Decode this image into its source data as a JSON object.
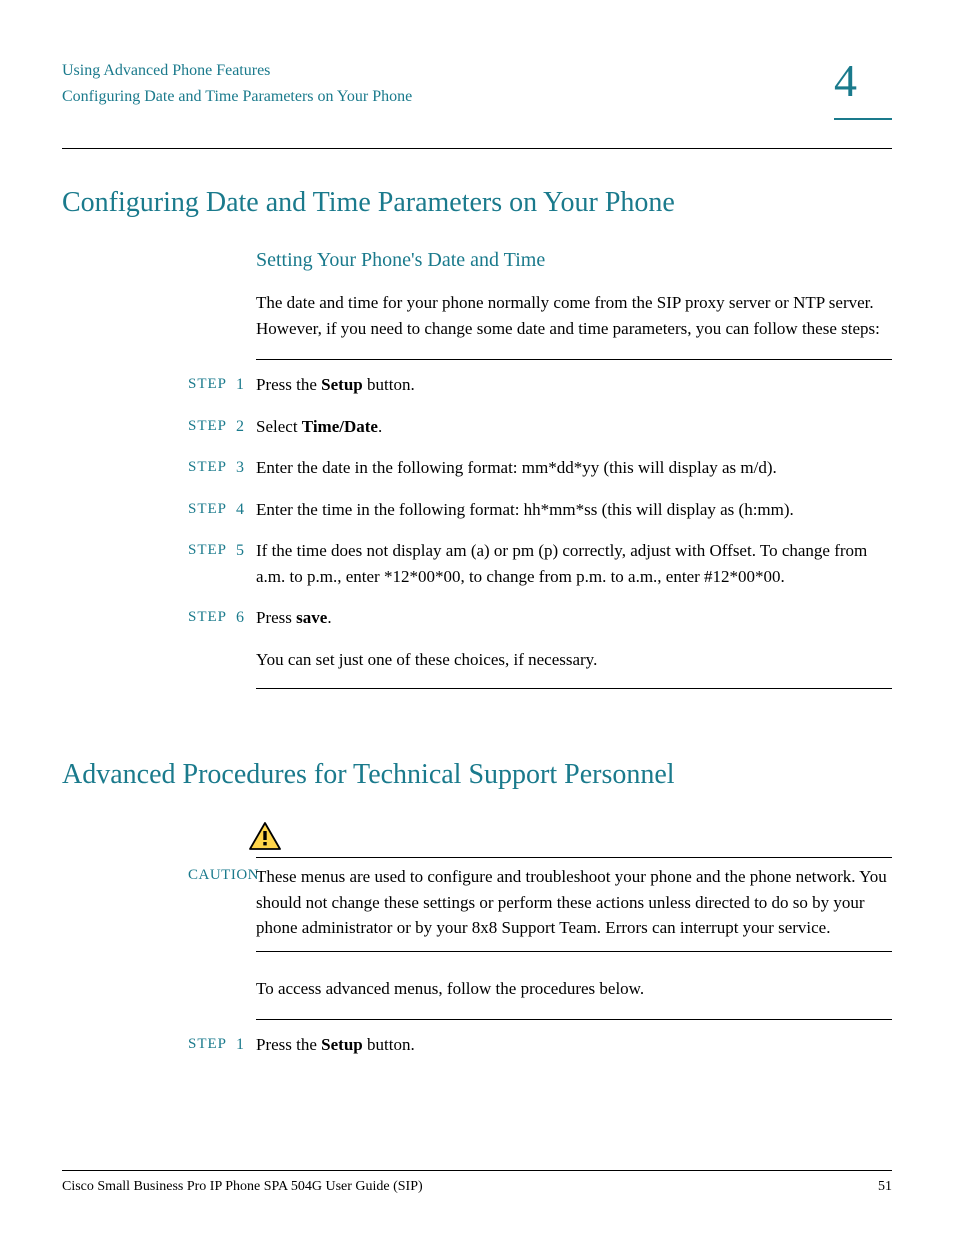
{
  "header": {
    "line1": "Using Advanced Phone Features",
    "line2": "Configuring Date and Time Parameters on Your Phone",
    "chapter": "4"
  },
  "section1": {
    "title": "Configuring Date and Time Parameters on Your Phone",
    "subsection": "Setting Your Phone's Date and Time",
    "intro": "The date and time for your phone normally come from the SIP proxy server or NTP server. However, if you need to change some date and time parameters, you can follow these steps:",
    "steps": [
      {
        "label": "STEP",
        "num": "1",
        "pre": "Press the ",
        "bold": "Setup",
        "post": " button."
      },
      {
        "label": "STEP",
        "num": "2",
        "pre": "Select ",
        "bold": "Time/Date",
        "post": "."
      },
      {
        "label": "STEP",
        "num": "3",
        "pre": "Enter the date in the following format: mm*dd*yy (this will display as m/d).",
        "bold": "",
        "post": ""
      },
      {
        "label": "STEP",
        "num": "4",
        "pre": "Enter the time in the following format: hh*mm*ss (this will display as (h:mm).",
        "bold": "",
        "post": ""
      },
      {
        "label": "STEP",
        "num": "5",
        "pre": "If the time does not display am (a) or pm (p) correctly, adjust with Offset. To change from a.m. to p.m., enter *12*00*00, to change from p.m. to a.m., enter #12*00*00.",
        "bold": "",
        "post": ""
      },
      {
        "label": "STEP",
        "num": "6",
        "pre": "Press ",
        "bold": "save",
        "post": "."
      }
    ],
    "note": "You can set just one of these choices, if necessary."
  },
  "section2": {
    "title": "Advanced Procedures for Technical Support Personnel",
    "caution_label": "CAUTION",
    "caution_text": "These menus are used to configure and troubleshoot your phone and the phone network. You should not change these settings or perform these actions unless directed to do so by your phone administrator or by your 8x8 Support Team. Errors can interrupt your service.",
    "intro": "To access advanced menus, follow the procedures below.",
    "steps": [
      {
        "label": "STEP",
        "num": "1",
        "pre": "Press the ",
        "bold": "Setup",
        "post": " button."
      }
    ]
  },
  "footer": {
    "left": "Cisco Small Business Pro IP Phone SPA 504G User Guide (SIP)",
    "right": "51"
  }
}
